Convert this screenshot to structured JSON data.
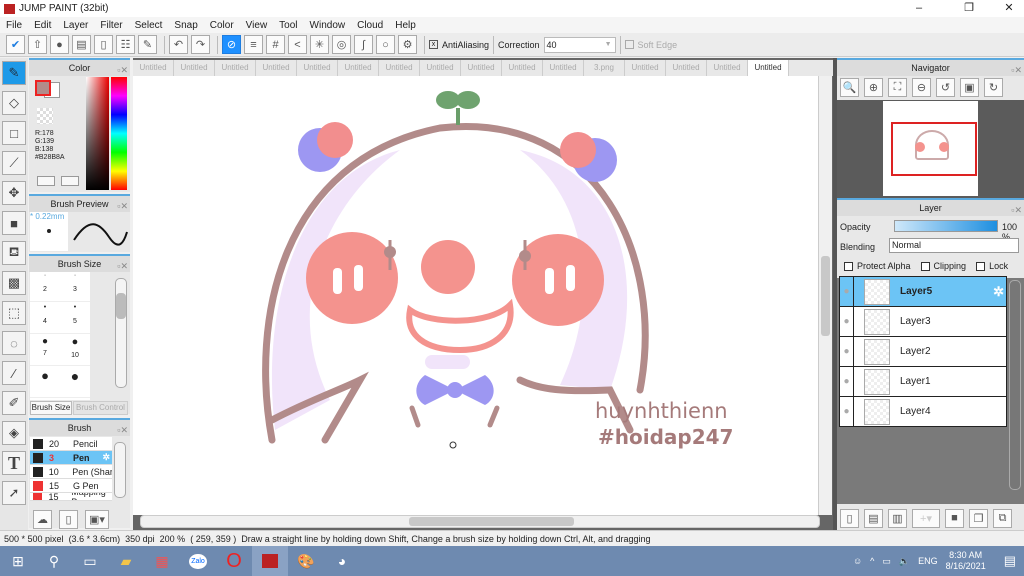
{
  "app": {
    "title": "JUMP PAINT (32bit)",
    "controls": [
      "–",
      "❐",
      "✕"
    ]
  },
  "menu": [
    "File",
    "Edit",
    "Layer",
    "Filter",
    "Select",
    "Snap",
    "Color",
    "View",
    "Tool",
    "Window",
    "Cloud",
    "Help"
  ],
  "toolbar": {
    "antialiasing_label": "AntiAliasing",
    "correction_label": "Correction",
    "correction_value": "40",
    "soft_edge_label": "Soft Edge"
  },
  "tabs": [
    "Untitled",
    "Untitled",
    "Untitled",
    "Untitled",
    "Untitled",
    "Untitled",
    "Untitled",
    "Untitled",
    "Untitled",
    "Untitled",
    "Untitled",
    "3.png",
    "Untitled",
    "Untitled",
    "Untitled",
    "Untitled"
  ],
  "color_panel": {
    "title": "Color",
    "r": "R:178",
    "g": "G:139",
    "b": "B:138",
    "hex": "#B28B8A",
    "main_color": "#B28B8A"
  },
  "brush_preview": {
    "title": "Brush Preview",
    "size": "* 0.22mm"
  },
  "brush_size": {
    "title": "Brush Size",
    "sizes": [
      "2",
      "3",
      "4",
      "5",
      "7",
      "10"
    ],
    "tabs": [
      "Brush Size",
      "Brush Control"
    ]
  },
  "brush": {
    "title": "Brush",
    "items": [
      {
        "size": "20",
        "name": "Pencil",
        "color": "#222222"
      },
      {
        "size": "3",
        "name": "Pen",
        "color": "#222222",
        "selected": true
      },
      {
        "size": "10",
        "name": "Pen (Shar",
        "color": "#222222"
      },
      {
        "size": "15",
        "name": "G Pen",
        "color": "#ee3333"
      },
      {
        "size": "15",
        "name": "Mapping P",
        "color": "#ee3333"
      }
    ]
  },
  "navigator": {
    "title": "Navigator"
  },
  "layer_panel": {
    "title": "Layer",
    "opacity_label": "Opacity",
    "opacity_value": "100 %",
    "opacity": 100,
    "blending_label": "Blending",
    "blending_value": "Normal",
    "protect_alpha": "Protect Alpha",
    "clipping": "Clipping",
    "lock": "Lock",
    "layers": [
      "Layer5",
      "Layer3",
      "Layer2",
      "Layer1",
      "Layer4"
    ]
  },
  "artwork": {
    "text1": "huynhthienn",
    "text2": "#hoidap247"
  },
  "status": {
    "size": "500 * 500 pixel",
    "cm": "(3.6 * 3.6cm)",
    "dpi": "350 dpi",
    "zoom": "200 %",
    "coords": "( 259, 359 )",
    "hint": "Draw a straight line by holding down Shift, Change a brush size by holding down Ctrl, Alt, and dragging"
  },
  "taskbar": {
    "lang": "ENG",
    "time": "8:30 AM",
    "date": "8/16/2021"
  }
}
